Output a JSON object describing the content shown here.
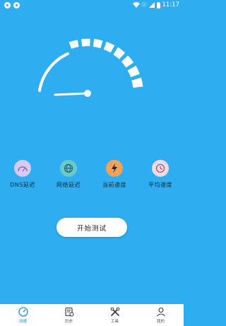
{
  "status": {
    "time": "11:17",
    "network": "ⓧ"
  },
  "gauge": {
    "segments_total": 8,
    "segments_lit": 8
  },
  "metrics": [
    {
      "label": "DNS延迟",
      "icon": "speedometer-icon",
      "color": "#d9c8f0"
    },
    {
      "label": "网络延迟",
      "icon": "globe-icon",
      "color": "#6cc9c9"
    },
    {
      "label": "当前速度",
      "icon": "lightning-icon",
      "color": "#f4a25a"
    },
    {
      "label": "平均速度",
      "icon": "clock-icon",
      "color": "#f2d8e0"
    }
  ],
  "start_button": "开始测试",
  "tabs": [
    {
      "label": "测速",
      "icon": "speed-icon",
      "active": true
    },
    {
      "label": "历史",
      "icon": "history-icon",
      "active": false
    },
    {
      "label": "工具",
      "icon": "tools-icon",
      "active": false
    },
    {
      "label": "我的",
      "icon": "profile-icon",
      "active": false
    }
  ],
  "colors": {
    "background": "#2eaef0",
    "accent": "#1f8fd8"
  }
}
